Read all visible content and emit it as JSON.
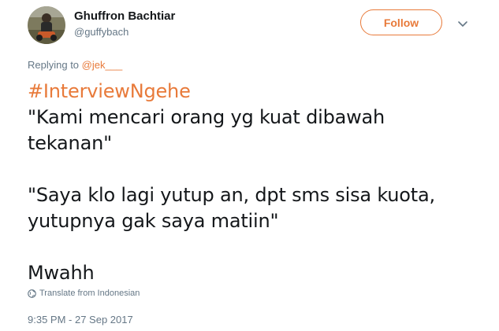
{
  "author": {
    "display_name": "Ghuffron Bachtiar",
    "handle": "@guffybach",
    "avatar_icon": "user-photo"
  },
  "follow_label": "Follow",
  "menu_icon": "chevron-down-icon",
  "reply": {
    "prefix": "Replying to",
    "mention": "@jek___"
  },
  "tweet": {
    "hashtag": "#InterviewNgehe",
    "lines": [
      "\"Kami mencari orang yg kuat dibawah",
      "tekanan\"",
      "",
      "\"Saya klo lagi yutup an, dpt sms sisa kuota,",
      "yutupnya gak saya matiin\"",
      "",
      "Mwahh"
    ]
  },
  "translate": {
    "icon": "globe-icon",
    "label": "Translate from Indonesian"
  },
  "timestamp": "9:35 PM - 27 Sep 2017",
  "colors": {
    "accent": "#e87a3a",
    "text": "#14171a",
    "muted": "#657786"
  }
}
